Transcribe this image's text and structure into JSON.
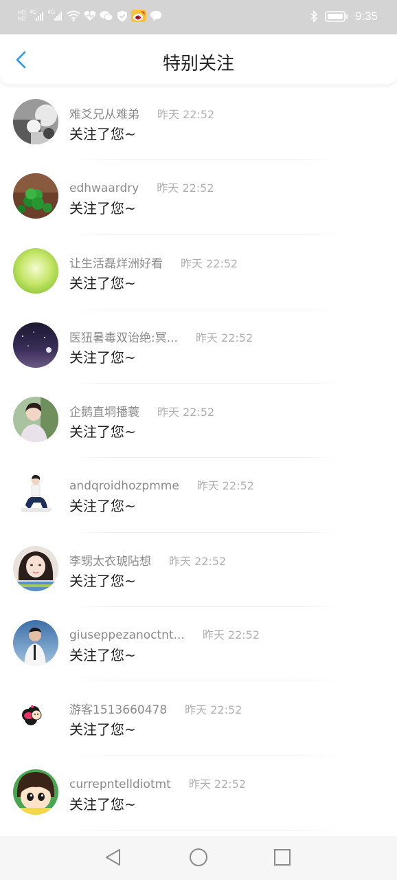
{
  "status_bar": {
    "time": "9:35",
    "hd1": "HD",
    "hd2": "HD",
    "net1": "4G",
    "net2": "4G",
    "icons": [
      "hd-icon",
      "signal-icon",
      "signal-icon",
      "wifi-icon",
      "health-icon",
      "wechat-icon",
      "shield-icon",
      "weibo-icon",
      "message-icon",
      "bluetooth-icon",
      "battery-icon"
    ],
    "weibo_color": "#e6162d"
  },
  "header": {
    "title": "特别关注",
    "back_icon": "chevron-left-icon",
    "accent_color": "#2196f3"
  },
  "items": [
    {
      "name": "难爻兄从难弟",
      "time": "昨天 22:52",
      "message": "关注了您~"
    },
    {
      "name": "edhwaardry",
      "time": "昨天 22:52",
      "message": "关注了您~"
    },
    {
      "name": "让生活磊烊洲好看",
      "time": "昨天 22:52",
      "message": "关注了您~"
    },
    {
      "name": "医狃暑毒双诒绝:冥...",
      "time": "昨天 22:52",
      "message": "关注了您~"
    },
    {
      "name": "企鹅直垌播蓑",
      "time": "昨天 22:52",
      "message": "关注了您~"
    },
    {
      "name": "andqroidhozpmme",
      "time": "昨天 22:52",
      "message": "关注了您~"
    },
    {
      "name": "李甥太衣琥阽想",
      "time": "昨天 22:52",
      "message": "关注了您~"
    },
    {
      "name": "giuseppezanoctnt...",
      "time": "昨天 22:52",
      "message": "关注了您~"
    },
    {
      "name": "游客1513660478",
      "time": "昨天 22:52",
      "message": "关注了您~"
    },
    {
      "name": "currepntelldiotmt",
      "time": "昨天 22:52",
      "message": "关注了您~"
    }
  ],
  "nav": {
    "icons": [
      "back-triangle-icon",
      "home-circle-icon",
      "recents-square-icon"
    ]
  }
}
